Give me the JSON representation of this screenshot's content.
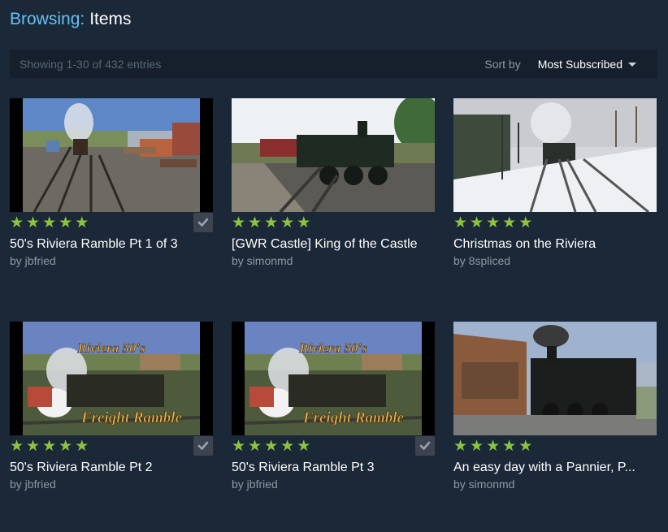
{
  "header": {
    "browsing_label": "Browsing:",
    "section": "Items"
  },
  "toolbar": {
    "showing": "Showing 1-30 of 432 entries",
    "sort_label": "Sort by",
    "sort_value": "Most Subscribed"
  },
  "colors": {
    "accent": "#66c0f4",
    "star": "#8bc53f",
    "background": "#1b2838"
  },
  "items": [
    {
      "title": "50's Riviera Ramble Pt 1 of 3",
      "author": "by jbfried",
      "rating": 5,
      "subscribed": true,
      "thumb": "station-yard"
    },
    {
      "title": "[GWR Castle] King of the Castle",
      "author": "by simonmd",
      "rating": 5,
      "subscribed": false,
      "thumb": "green-loco"
    },
    {
      "title": "Christmas on the Riviera",
      "author": "by 8spliced",
      "rating": 5,
      "subscribed": false,
      "thumb": "snow-track"
    },
    {
      "title": "50's Riviera Ramble Pt 2",
      "author": "by jbfried",
      "rating": 5,
      "subscribed": true,
      "thumb": "freight-ramble",
      "overlay_top": "Riviera 50's",
      "overlay_bottom": "Freight Ramble"
    },
    {
      "title": "50's Riviera Ramble Pt 3",
      "author": "by jbfried",
      "rating": 5,
      "subscribed": true,
      "thumb": "freight-ramble",
      "overlay_top": "Riviera 50's",
      "overlay_bottom": "Freight Ramble"
    },
    {
      "title": "An easy day with a Pannier, P...",
      "author": "by simonmd",
      "rating": 5,
      "subscribed": false,
      "thumb": "pannier-station"
    }
  ]
}
